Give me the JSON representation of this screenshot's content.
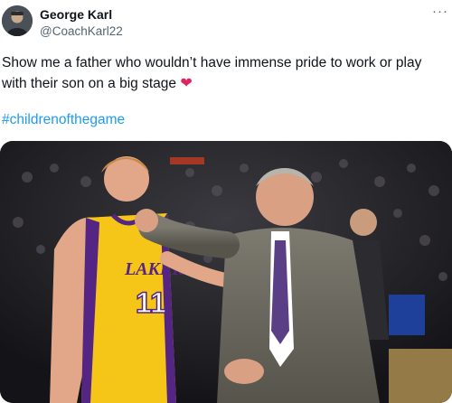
{
  "tweet": {
    "author_name": "George Karl",
    "author_handle": "@CoachKarl22",
    "more_icon": "more-horizontal-icon",
    "text": "Show me a father who wouldn’t have immense pride to work or play with their son on a big stage",
    "emoji": "❤",
    "hashtag": "#childrenofthegame"
  },
  "media": {
    "jersey_team": "LAKERS",
    "jersey_number": "11"
  },
  "colors": {
    "hashtag": "#1d9bf0",
    "heart": "#e0245e",
    "lakers_gold": "#f5c518",
    "lakers_purple": "#552583"
  }
}
